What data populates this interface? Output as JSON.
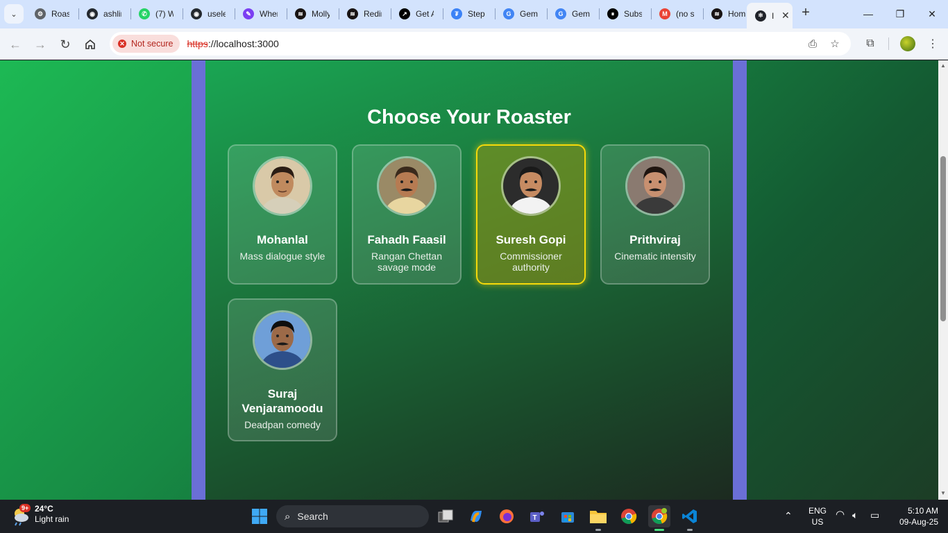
{
  "browser": {
    "tabs": [
      {
        "title": "Roast",
        "color": "#5f6368",
        "glyph": "⚙"
      },
      {
        "title": "ashlin",
        "color": "#24292f",
        "glyph": "◉"
      },
      {
        "title": "(7) W",
        "color": "#25d366",
        "glyph": "✆"
      },
      {
        "title": "usele",
        "color": "#24292f",
        "glyph": "◉"
      },
      {
        "title": "Wher",
        "color": "#7b3ff2",
        "glyph": "✎"
      },
      {
        "title": "Molly",
        "color": "#191414",
        "glyph": "≋"
      },
      {
        "title": "Redir",
        "color": "#191414",
        "glyph": "≋"
      },
      {
        "title": "Get A",
        "color": "#000000",
        "glyph": "↗"
      },
      {
        "title": "Step",
        "color": "#3b82f6",
        "glyph": "₮"
      },
      {
        "title": "Gemi",
        "color": "#4285f4",
        "glyph": "G"
      },
      {
        "title": "Gemi",
        "color": "#4285f4",
        "glyph": "G"
      },
      {
        "title": "Subs",
        "color": "#000000",
        "glyph": "⏸"
      },
      {
        "title": "(no s",
        "color": "#ea4335",
        "glyph": "M"
      },
      {
        "title": "Hom",
        "color": "#191414",
        "glyph": "≋"
      },
      {
        "title": "I",
        "color": "#20232a",
        "glyph": "⚛"
      }
    ],
    "active_tab_index": 14,
    "security_chip": "Not secure",
    "url_scheme": "https",
    "url_rest": "://localhost:3000"
  },
  "page": {
    "heading": "Choose Your Roaster",
    "roasters": [
      {
        "name": "Mohanlal",
        "description": "Mass dialogue style",
        "selected": false
      },
      {
        "name": "Fahadh Faasil",
        "description": "Rangan Chettan savage mode",
        "selected": false
      },
      {
        "name": "Suresh Gopi",
        "description": "Commissioner authority",
        "selected": true
      },
      {
        "name": "Prithviraj",
        "description": "Cinematic intensity",
        "selected": false
      },
      {
        "name": "Suraj Venjaramoodu",
        "description": "Deadpan comedy",
        "selected": false
      }
    ]
  },
  "taskbar": {
    "weather_badge": "9+",
    "temperature": "24°C",
    "condition": "Light rain",
    "search_placeholder": "Search",
    "language": "ENG",
    "region": "US",
    "time": "5:10 AM",
    "date": "09-Aug-25"
  }
}
